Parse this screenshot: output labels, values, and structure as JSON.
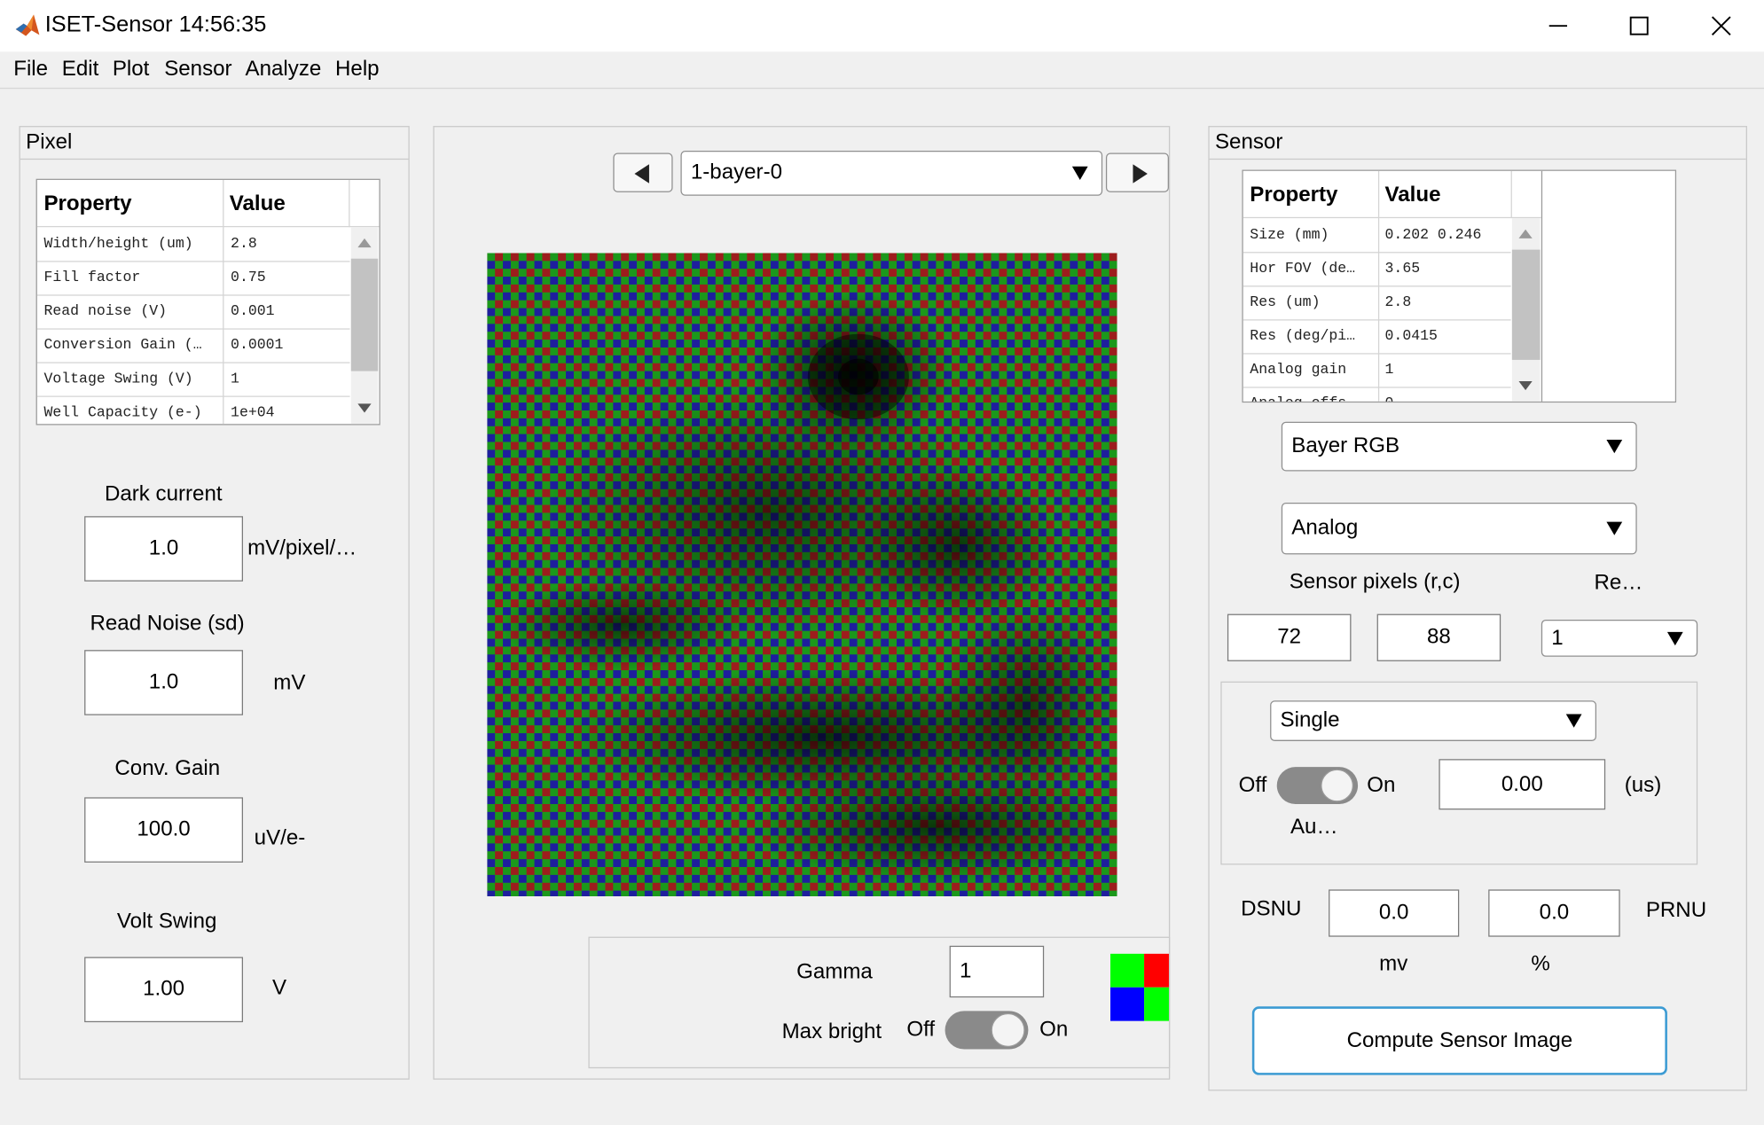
{
  "window": {
    "title": "ISET-Sensor 14:56:35"
  },
  "menu": [
    "File",
    "Edit",
    "Plot",
    "Sensor",
    "Analyze",
    "Help"
  ],
  "pixel_panel": {
    "title": "Pixel",
    "table": {
      "headers": [
        "Property",
        "Value"
      ],
      "rows": [
        [
          "Width/height (um)",
          "2.8"
        ],
        [
          "Fill factor",
          "0.75"
        ],
        [
          "Read noise (V)",
          "0.001"
        ],
        [
          "Conversion Gain (…",
          "0.0001"
        ],
        [
          "Voltage Swing (V)",
          "1"
        ],
        [
          "Well Capacity (e-)",
          "1e+04"
        ]
      ]
    },
    "dark_current": {
      "label": "Dark current",
      "value": "1.0",
      "unit": "mV/pixel/…"
    },
    "read_noise": {
      "label": "Read Noise (sd)",
      "value": "1.0",
      "unit": "mV"
    },
    "conv_gain": {
      "label": "Conv. Gain",
      "value": "100.0",
      "unit": "uV/e-"
    },
    "volt_swing": {
      "label": "Volt Swing",
      "value": "1.00",
      "unit": "V"
    }
  },
  "center": {
    "selector": "1-bayer-0",
    "gamma_label": "Gamma",
    "gamma_value": "1",
    "max_bright_label": "Max bright",
    "off_label": "Off",
    "on_label": "On",
    "cfa_colors": [
      "#00ff00",
      "#ff0000",
      "#0000ff",
      "#00ff00"
    ]
  },
  "sensor_panel": {
    "title": "Sensor",
    "table": {
      "headers": [
        "Property",
        "Value"
      ],
      "rows": [
        [
          "Size (mm)",
          "0.202 0.246"
        ],
        [
          "Hor FOV (de…",
          "3.65"
        ],
        [
          "Res (um)",
          "2.8"
        ],
        [
          "Res (deg/pi…",
          "0.0415"
        ],
        [
          "Analog gain",
          "1"
        ],
        [
          "Analog offs…",
          "0"
        ]
      ]
    },
    "cfa_dropdown": "Bayer RGB",
    "quant_dropdown": "Analog",
    "sensor_pixels_label": "Sensor pixels  (r,c)",
    "re_label": "Re…",
    "rows": "72",
    "cols": "88",
    "re_value": "1",
    "exposure_mode": "Single",
    "off_label": "Off",
    "on_label": "On",
    "auto_label": "Au…",
    "exposure_value": "0.00",
    "exposure_unit": "(us)",
    "dsnu_label": "DSNU",
    "dsnu_value": "0.0",
    "dsnu_unit": "mv",
    "prnu_value": "0.0",
    "prnu_unit": "%",
    "prnu_label": "PRNU",
    "compute_label": "Compute Sensor  Image"
  }
}
